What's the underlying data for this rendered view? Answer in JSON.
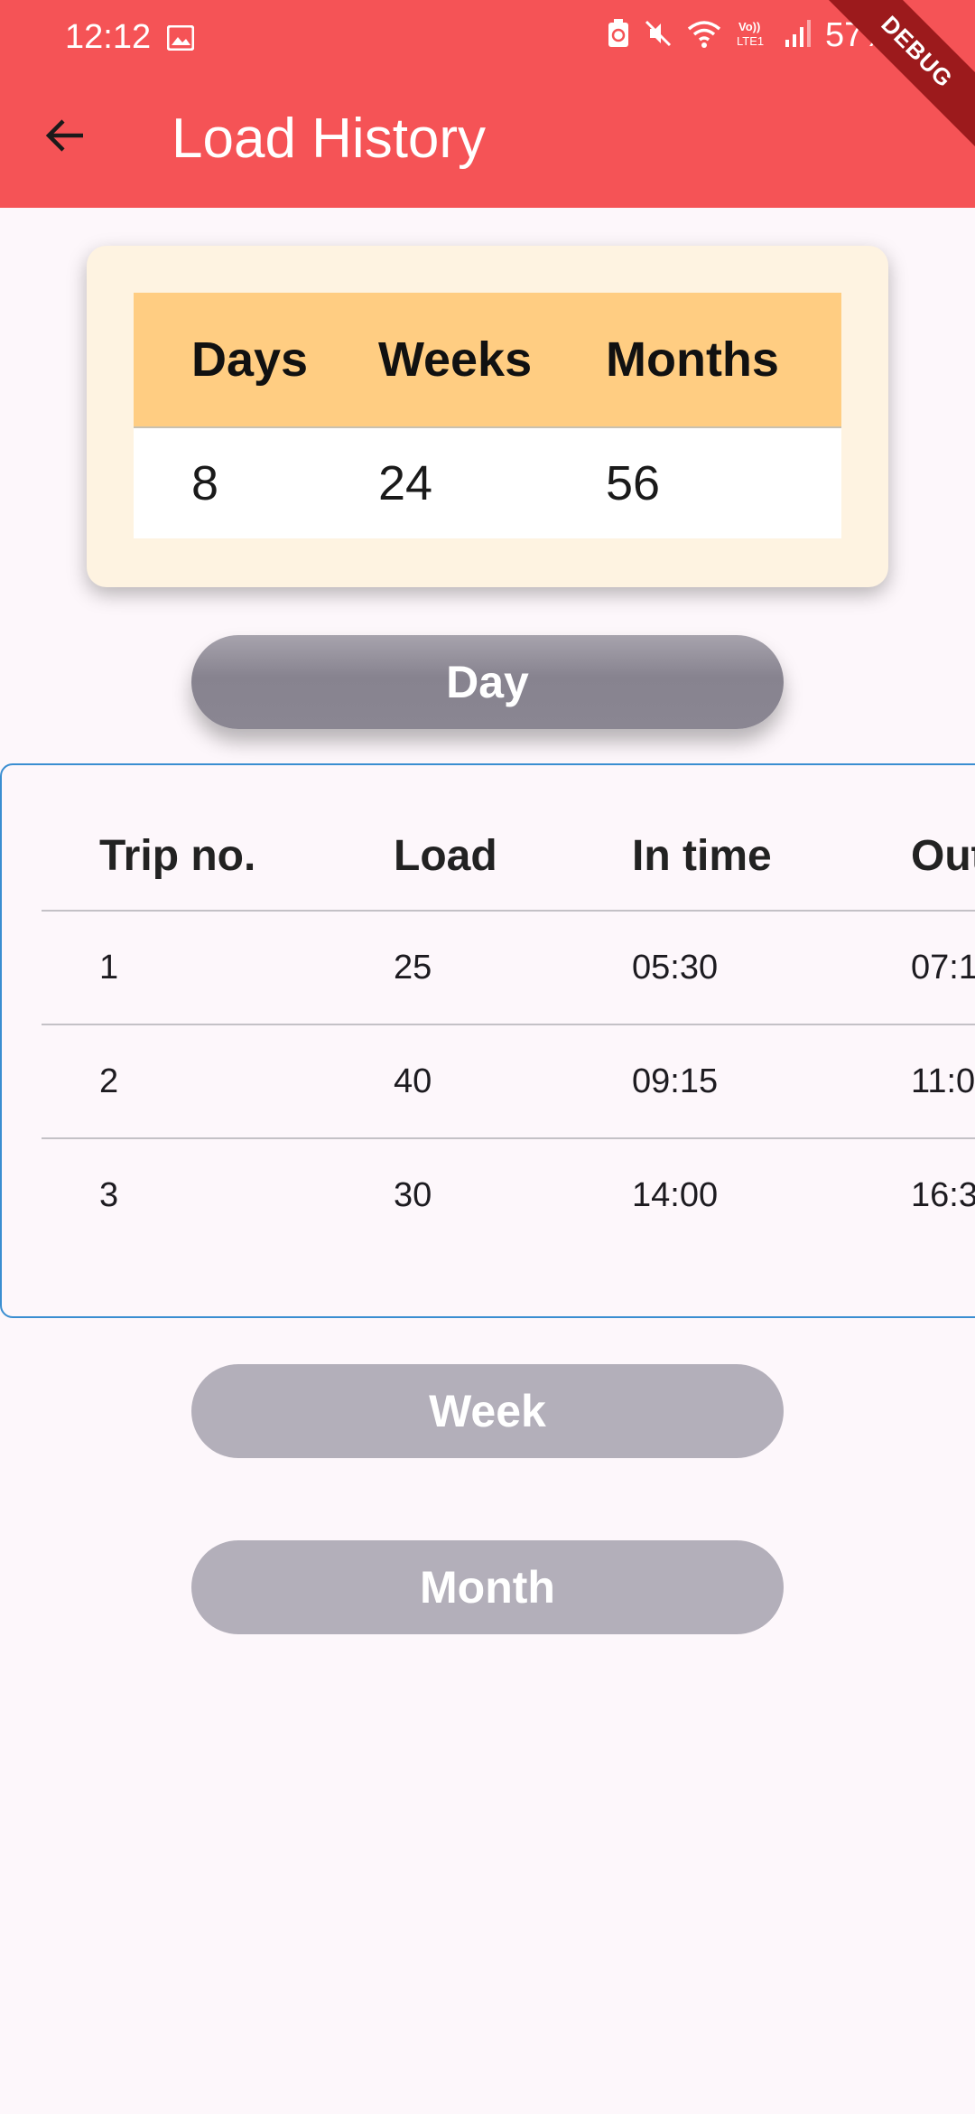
{
  "status_bar": {
    "time": "12:12",
    "battery_percent": "57%",
    "icons": [
      "image-icon",
      "battery-saver-icon",
      "mute-icon",
      "wifi-icon",
      "volte-lte-icon",
      "signal-icon"
    ]
  },
  "debug_banner": "DEBUG",
  "app_bar": {
    "back_icon": "arrow-back-icon",
    "title": "Load History",
    "background": "#f55356"
  },
  "summary": {
    "headers": [
      "Days",
      "Weeks",
      "Months"
    ],
    "values": [
      "8",
      "24",
      "56"
    ]
  },
  "buttons": {
    "day": "Day",
    "week": "Week",
    "month": "Month"
  },
  "trip_table": {
    "headers": [
      "Trip no.",
      "Load",
      "In time",
      "Out"
    ],
    "rows": [
      [
        "1",
        "25",
        "05:30",
        "07:1"
      ],
      [
        "2",
        "40",
        "09:15",
        "11:0"
      ],
      [
        "3",
        "30",
        "14:00",
        "16:3"
      ]
    ]
  }
}
